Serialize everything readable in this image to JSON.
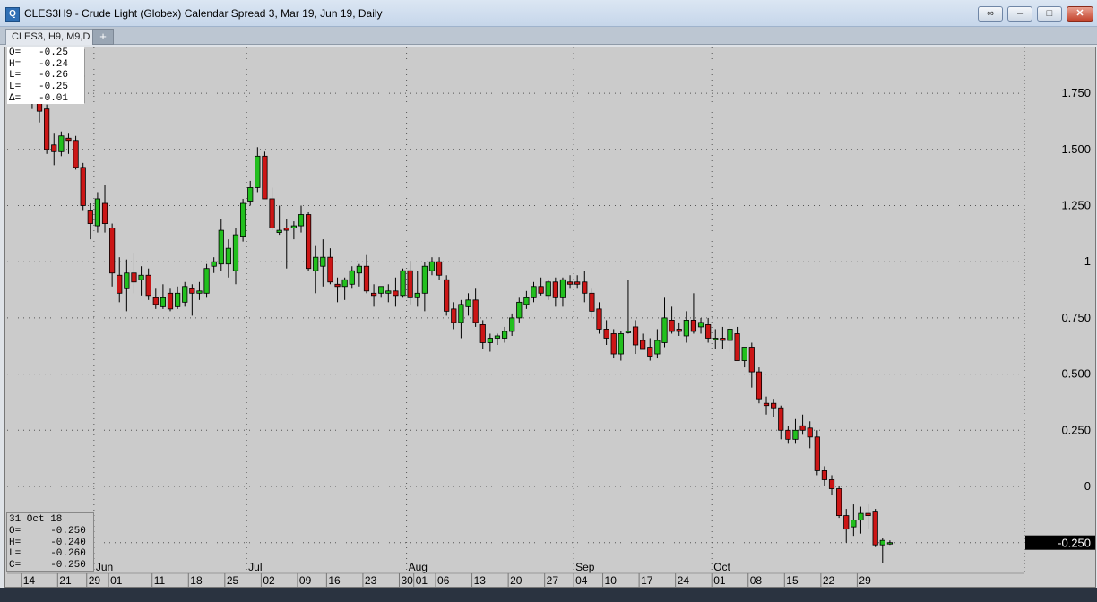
{
  "window": {
    "title": "CLES3H9 - Crude Light (Globex) Calendar Spread 3, Mar 19, Jun 19, Daily",
    "tab_label": "CLES3, H9, M9,D",
    "add_tab_label": "+"
  },
  "ohlc_legend": [
    "O=   -0.25",
    "H=   -0.24",
    "L=   -0.26",
    "L=   -0.25",
    "Δ=   -0.01"
  ],
  "bar_info": {
    "date": "31 Oct 18",
    "rows": [
      "O=     -0.250",
      "H=     -0.240",
      "L=     -0.260",
      "C=     -0.250"
    ]
  },
  "colors": {
    "up": "#22c01e",
    "down": "#cc1616",
    "background": "#cbcbcb",
    "price_tag": "#000000"
  },
  "chart_data": {
    "type": "candlestick",
    "title": "",
    "ylim": [
      -0.39,
      1.96
    ],
    "y_ticks": [
      {
        "value": 1.75,
        "label": "1.750"
      },
      {
        "value": 1.5,
        "label": "1.500"
      },
      {
        "value": 1.25,
        "label": "1.250"
      },
      {
        "value": 1.0,
        "label": "1"
      },
      {
        "value": 0.75,
        "label": "0.750"
      },
      {
        "value": 0.5,
        "label": "0.500"
      },
      {
        "value": 0.25,
        "label": "0.250"
      },
      {
        "value": 0.0,
        "label": "0"
      },
      {
        "value": -0.25,
        "label": "-0.250"
      }
    ],
    "last_price": {
      "value": -0.25,
      "label": "-0.250"
    },
    "month_labels": [
      {
        "label": "Jun",
        "index": 11
      },
      {
        "label": "Jul",
        "index": 32
      },
      {
        "label": "Aug",
        "index": 54
      },
      {
        "label": "Sep",
        "index": 77
      },
      {
        "label": "Oct",
        "index": 96
      }
    ],
    "day_labels": [
      {
        "label": "14",
        "index": 1
      },
      {
        "label": "21",
        "index": 6
      },
      {
        "label": "29",
        "index": 10
      },
      {
        "label": "01",
        "index": 13
      },
      {
        "label": "11",
        "index": 19
      },
      {
        "label": "18",
        "index": 24
      },
      {
        "label": "25",
        "index": 29
      },
      {
        "label": "02",
        "index": 34
      },
      {
        "label": "09",
        "index": 39
      },
      {
        "label": "16",
        "index": 43
      },
      {
        "label": "23",
        "index": 48
      },
      {
        "label": "30",
        "index": 53
      },
      {
        "label": "01",
        "index": 55
      },
      {
        "label": "06",
        "index": 58
      },
      {
        "label": "13",
        "index": 63
      },
      {
        "label": "20",
        "index": 68
      },
      {
        "label": "27",
        "index": 73
      },
      {
        "label": "04",
        "index": 77
      },
      {
        "label": "10",
        "index": 81
      },
      {
        "label": "17",
        "index": 86
      },
      {
        "label": "24",
        "index": 91
      },
      {
        "label": "01",
        "index": 96
      },
      {
        "label": "08",
        "index": 101
      },
      {
        "label": "15",
        "index": 106
      },
      {
        "label": "22",
        "index": 111
      },
      {
        "label": "29",
        "index": 116
      }
    ],
    "candles": [
      [
        1.85,
        1.88,
        1.78,
        1.82
      ],
      [
        1.8,
        1.83,
        1.73,
        1.75
      ],
      [
        1.78,
        1.82,
        1.68,
        1.72
      ],
      [
        1.72,
        1.75,
        1.62,
        1.67
      ],
      [
        1.68,
        1.7,
        1.48,
        1.5
      ],
      [
        1.52,
        1.57,
        1.43,
        1.49
      ],
      [
        1.49,
        1.58,
        1.47,
        1.56
      ],
      [
        1.55,
        1.57,
        1.48,
        1.54
      ],
      [
        1.54,
        1.56,
        1.41,
        1.42
      ],
      [
        1.42,
        1.44,
        1.23,
        1.25
      ],
      [
        1.23,
        1.26,
        1.1,
        1.17
      ],
      [
        1.16,
        1.31,
        1.13,
        1.28
      ],
      [
        1.26,
        1.34,
        1.13,
        1.17
      ],
      [
        1.15,
        1.17,
        0.89,
        0.95
      ],
      [
        0.94,
        1.02,
        0.82,
        0.86
      ],
      [
        0.88,
        1.01,
        0.78,
        0.95
      ],
      [
        0.95,
        1.04,
        0.86,
        0.91
      ],
      [
        0.92,
        0.98,
        0.85,
        0.94
      ],
      [
        0.94,
        0.97,
        0.83,
        0.85
      ],
      [
        0.84,
        0.88,
        0.79,
        0.81
      ],
      [
        0.8,
        0.9,
        0.79,
        0.84
      ],
      [
        0.86,
        0.88,
        0.78,
        0.79
      ],
      [
        0.8,
        0.89,
        0.79,
        0.86
      ],
      [
        0.82,
        0.91,
        0.8,
        0.89
      ],
      [
        0.88,
        0.9,
        0.76,
        0.86
      ],
      [
        0.86,
        0.91,
        0.83,
        0.87
      ],
      [
        0.86,
        0.99,
        0.84,
        0.97
      ],
      [
        0.98,
        1.02,
        0.95,
        1.0
      ],
      [
        0.99,
        1.19,
        0.96,
        1.14
      ],
      [
        0.99,
        1.1,
        0.93,
        1.06
      ],
      [
        0.96,
        1.15,
        0.9,
        1.12
      ],
      [
        1.11,
        1.28,
        1.09,
        1.26
      ],
      [
        1.27,
        1.36,
        1.25,
        1.33
      ],
      [
        1.33,
        1.51,
        1.31,
        1.47
      ],
      [
        1.47,
        1.49,
        1.3,
        1.28
      ],
      [
        1.28,
        1.33,
        1.14,
        1.15
      ],
      [
        1.13,
        1.25,
        1.12,
        1.14
      ],
      [
        1.15,
        1.19,
        0.97,
        1.14
      ],
      [
        1.15,
        1.18,
        1.1,
        1.16
      ],
      [
        1.16,
        1.25,
        1.13,
        1.21
      ],
      [
        1.21,
        1.22,
        0.96,
        0.97
      ],
      [
        0.96,
        1.07,
        0.86,
        1.02
      ],
      [
        0.98,
        1.1,
        0.89,
        1.02
      ],
      [
        1.02,
        1.06,
        0.9,
        0.91
      ],
      [
        0.9,
        0.93,
        0.82,
        0.89
      ],
      [
        0.89,
        0.93,
        0.83,
        0.92
      ],
      [
        0.9,
        0.98,
        0.88,
        0.96
      ],
      [
        0.95,
        0.99,
        0.89,
        0.98
      ],
      [
        0.98,
        1.03,
        0.86,
        0.87
      ],
      [
        0.86,
        0.9,
        0.8,
        0.85
      ],
      [
        0.86,
        0.89,
        0.84,
        0.89
      ],
      [
        0.86,
        0.9,
        0.82,
        0.87
      ],
      [
        0.87,
        0.93,
        0.8,
        0.85
      ],
      [
        0.85,
        0.97,
        0.84,
        0.96
      ],
      [
        0.96,
        1.0,
        0.81,
        0.84
      ],
      [
        0.84,
        0.96,
        0.8,
        0.86
      ],
      [
        0.86,
        1.0,
        0.78,
        0.98
      ],
      [
        0.96,
        1.02,
        0.94,
        1.0
      ],
      [
        1.0,
        1.02,
        0.92,
        0.94
      ],
      [
        0.92,
        0.94,
        0.76,
        0.78
      ],
      [
        0.79,
        0.82,
        0.7,
        0.73
      ],
      [
        0.73,
        0.83,
        0.66,
        0.81
      ],
      [
        0.8,
        0.86,
        0.76,
        0.83
      ],
      [
        0.83,
        0.88,
        0.71,
        0.73
      ],
      [
        0.72,
        0.74,
        0.61,
        0.64
      ],
      [
        0.64,
        0.68,
        0.6,
        0.66
      ],
      [
        0.66,
        0.68,
        0.63,
        0.67
      ],
      [
        0.66,
        0.71,
        0.64,
        0.69
      ],
      [
        0.69,
        0.77,
        0.67,
        0.75
      ],
      [
        0.75,
        0.84,
        0.73,
        0.82
      ],
      [
        0.81,
        0.87,
        0.79,
        0.84
      ],
      [
        0.84,
        0.91,
        0.82,
        0.89
      ],
      [
        0.89,
        0.93,
        0.85,
        0.86
      ],
      [
        0.85,
        0.92,
        0.83,
        0.91
      ],
      [
        0.91,
        0.93,
        0.8,
        0.84
      ],
      [
        0.84,
        0.93,
        0.8,
        0.92
      ],
      [
        0.91,
        0.94,
        0.88,
        0.9
      ],
      [
        0.91,
        0.94,
        0.88,
        0.9
      ],
      [
        0.91,
        0.96,
        0.82,
        0.86
      ],
      [
        0.86,
        0.88,
        0.75,
        0.78
      ],
      [
        0.79,
        0.82,
        0.68,
        0.7
      ],
      [
        0.7,
        0.74,
        0.63,
        0.66
      ],
      [
        0.68,
        0.7,
        0.57,
        0.59
      ],
      [
        0.59,
        0.69,
        0.56,
        0.68
      ],
      [
        0.69,
        0.92,
        0.68,
        0.69
      ],
      [
        0.71,
        0.74,
        0.59,
        0.63
      ],
      [
        0.65,
        0.68,
        0.61,
        0.61
      ],
      [
        0.62,
        0.66,
        0.56,
        0.58
      ],
      [
        0.59,
        0.7,
        0.57,
        0.65
      ],
      [
        0.64,
        0.84,
        0.62,
        0.75
      ],
      [
        0.74,
        0.8,
        0.68,
        0.69
      ],
      [
        0.7,
        0.73,
        0.67,
        0.69
      ],
      [
        0.67,
        0.78,
        0.64,
        0.74
      ],
      [
        0.74,
        0.86,
        0.68,
        0.69
      ],
      [
        0.71,
        0.75,
        0.68,
        0.73
      ],
      [
        0.72,
        0.75,
        0.64,
        0.66
      ],
      [
        0.66,
        0.7,
        0.61,
        0.66
      ],
      [
        0.66,
        0.71,
        0.61,
        0.65
      ],
      [
        0.65,
        0.72,
        0.6,
        0.7
      ],
      [
        0.68,
        0.71,
        0.6,
        0.56
      ],
      [
        0.56,
        0.61,
        0.53,
        0.62
      ],
      [
        0.62,
        0.64,
        0.44,
        0.51
      ],
      [
        0.51,
        0.53,
        0.37,
        0.39
      ],
      [
        0.37,
        0.4,
        0.32,
        0.36
      ],
      [
        0.37,
        0.39,
        0.31,
        0.35
      ],
      [
        0.35,
        0.36,
        0.21,
        0.25
      ],
      [
        0.25,
        0.27,
        0.19,
        0.21
      ],
      [
        0.21,
        0.3,
        0.19,
        0.25
      ],
      [
        0.27,
        0.32,
        0.23,
        0.25
      ],
      [
        0.26,
        0.29,
        0.17,
        0.22
      ],
      [
        0.22,
        0.25,
        0.05,
        0.07
      ],
      [
        0.07,
        0.09,
        0.0,
        0.03
      ],
      [
        0.03,
        0.05,
        -0.04,
        -0.01
      ],
      [
        -0.01,
        0.0,
        -0.14,
        -0.13
      ],
      [
        -0.13,
        -0.1,
        -0.25,
        -0.19
      ],
      [
        -0.18,
        -0.08,
        -0.22,
        -0.15
      ],
      [
        -0.15,
        -0.09,
        -0.21,
        -0.12
      ],
      [
        -0.12,
        -0.08,
        -0.19,
        -0.13
      ],
      [
        -0.11,
        -0.1,
        -0.27,
        -0.26
      ],
      [
        -0.26,
        -0.23,
        -0.34,
        -0.24
      ],
      [
        -0.25,
        -0.24,
        -0.26,
        -0.25
      ]
    ]
  }
}
